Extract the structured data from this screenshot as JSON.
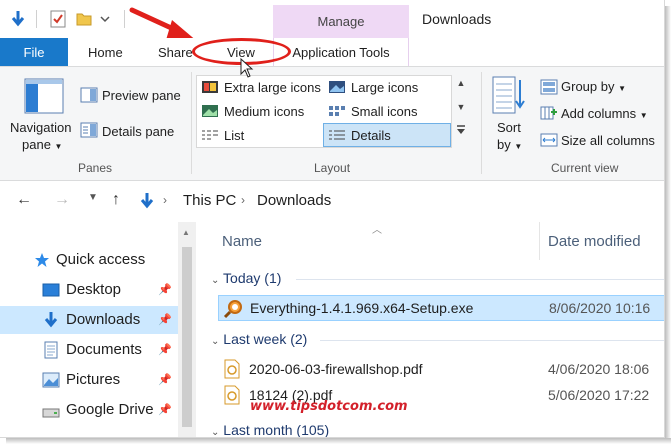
{
  "window": {
    "title": "Downloads",
    "context_tab": "Manage"
  },
  "tabs": {
    "file": "File",
    "home": "Home",
    "share": "Share",
    "view": "View",
    "app_tools": "Application Tools"
  },
  "ribbon": {
    "panes": {
      "navigation_pane_line1": "Navigation",
      "navigation_pane_line2": "pane",
      "preview_pane": "Preview pane",
      "details_pane": "Details pane",
      "group_label": "Panes"
    },
    "layout": {
      "extra_large_icons": "Extra large icons",
      "large_icons": "Large icons",
      "medium_icons": "Medium icons",
      "small_icons": "Small icons",
      "list": "List",
      "details": "Details",
      "group_label": "Layout"
    },
    "current_view": {
      "sort_by_line1": "Sort",
      "sort_by_line2": "by",
      "group_by": "Group by",
      "add_columns": "Add columns",
      "size_all_columns": "Size all columns",
      "group_label": "Current view"
    }
  },
  "address": {
    "crumbs": [
      "This PC",
      "Downloads"
    ]
  },
  "nav": {
    "items": [
      {
        "label": "Quick access"
      },
      {
        "label": "Desktop"
      },
      {
        "label": "Downloads"
      },
      {
        "label": "Documents"
      },
      {
        "label": "Pictures"
      },
      {
        "label": "Google Drive"
      }
    ]
  },
  "files": {
    "columns": {
      "name": "Name",
      "date": "Date modified"
    },
    "groups": [
      {
        "label": "Today (1)",
        "rows": [
          {
            "name": "Everything-1.4.1.969.x64-Setup.exe",
            "date": "8/06/2020 10:16"
          }
        ]
      },
      {
        "label": "Last week (2)",
        "rows": [
          {
            "name": "2020-06-03-firewallshop.pdf",
            "date": "4/06/2020 18:06"
          },
          {
            "name": "18124 (2).pdf",
            "date": "5/06/2020 17:22"
          }
        ]
      },
      {
        "label": "Last month (105)",
        "rows": []
      }
    ]
  },
  "watermark": "www.tipsdotcom.com",
  "colors": {
    "file_tab": "#1979ca",
    "manage_tab": "#efd9f5",
    "selection": "#cce8ff",
    "annotation_red": "#e0201b"
  }
}
